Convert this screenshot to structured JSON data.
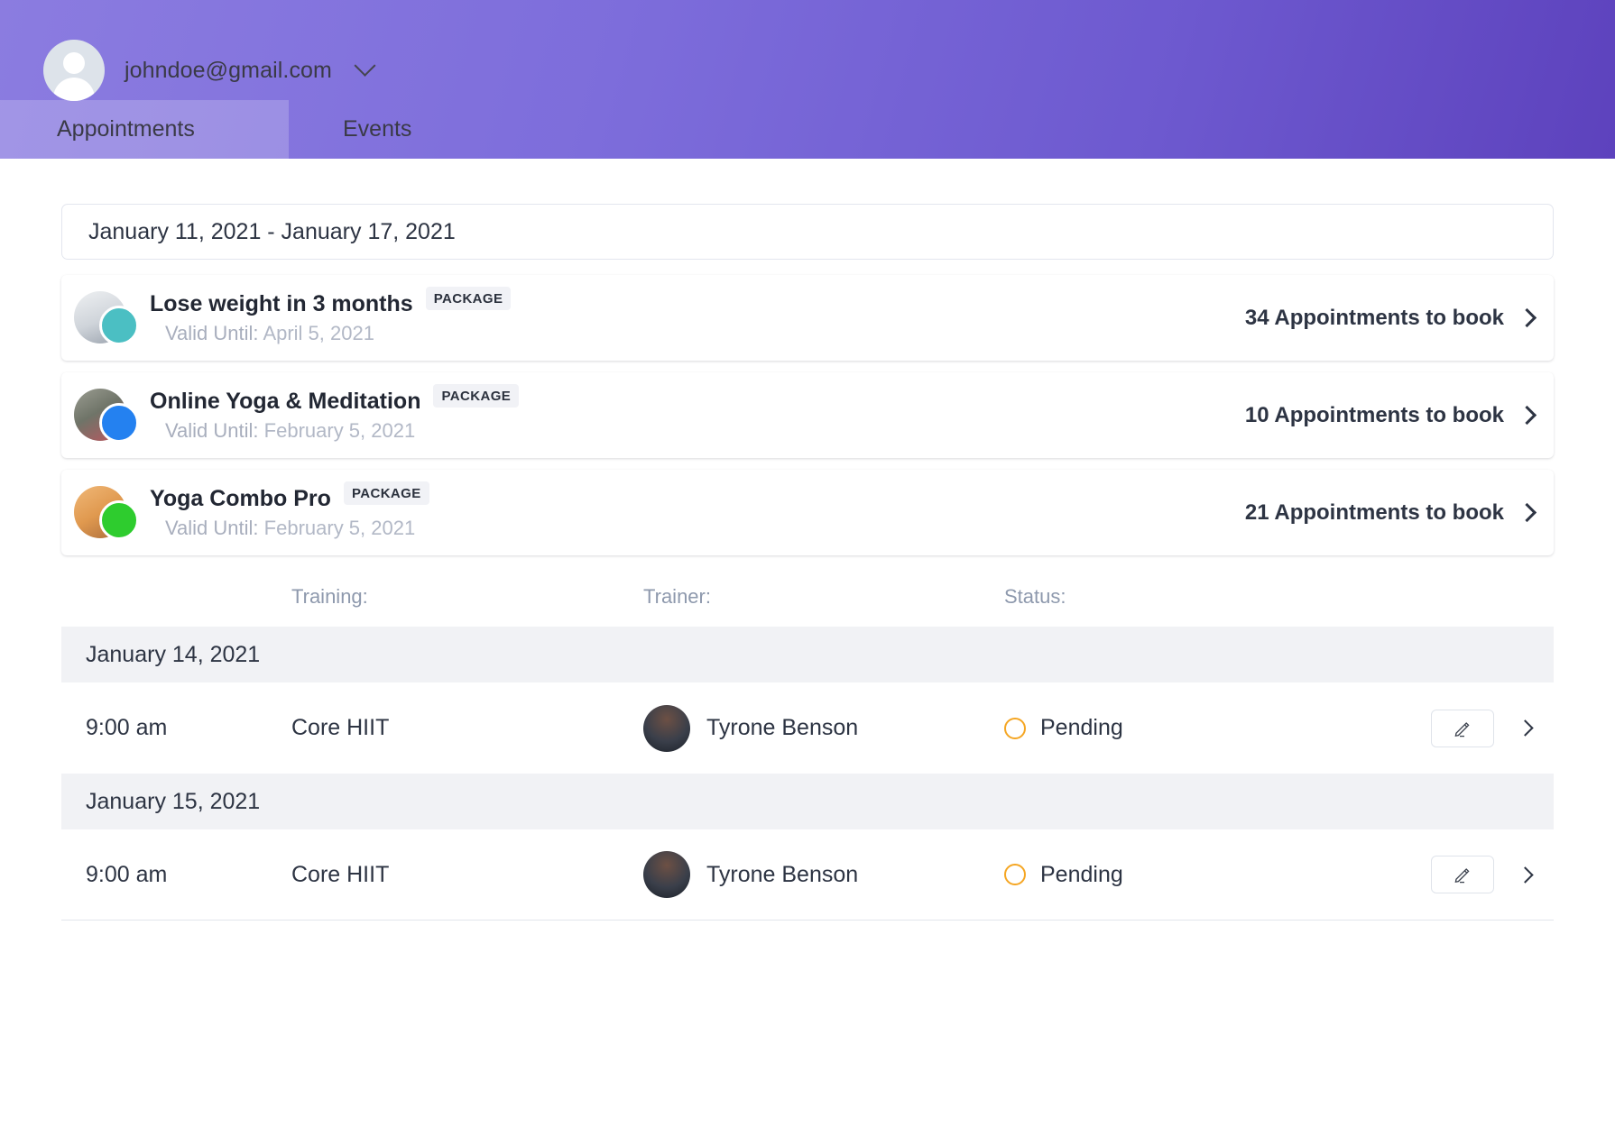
{
  "header": {
    "account_email": "johndoe@gmail.com",
    "avatar_icon": "user-avatar-icon",
    "dropdown_icon": "chevron-down-icon",
    "gradient_from": "#8b7ce0",
    "gradient_to": "#5d42bd"
  },
  "tabs": [
    {
      "label": "Appointments",
      "active": true
    },
    {
      "label": "Events",
      "active": false
    }
  ],
  "date_range": {
    "value": "January 11, 2021 - January 17, 2021",
    "placeholder": "Select date range"
  },
  "packages": [
    {
      "title": "Lose weight in 3 months",
      "badge": "PACKAGE",
      "valid_label": "Valid Until:",
      "valid_date": "April 5, 2021",
      "count_text": "34 Appointments to book",
      "dot_color": "#4bbfc3",
      "photo_color": "#d6d9de"
    },
    {
      "title": "Online Yoga & Meditation",
      "badge": "PACKAGE",
      "valid_label": "Valid Until:",
      "valid_date": "February 5, 2021",
      "count_text": "10 Appointments to book",
      "dot_color": "#2481f0",
      "photo_color": "#8d8f83"
    },
    {
      "title": "Yoga Combo Pro",
      "badge": "PACKAGE",
      "valid_label": "Valid Until:",
      "valid_date": "February 5, 2021",
      "count_text": "21 Appointments to book",
      "dot_color": "#2ecc2e",
      "photo_color": "#e8a765"
    }
  ],
  "table": {
    "columns": {
      "time": "",
      "training": "Training:",
      "trainer": "Trainer:",
      "status": "Status:"
    },
    "groups": [
      {
        "date": "January 14, 2021",
        "rows": [
          {
            "time": "9:00 am",
            "training": "Core HIIT",
            "trainer": "Tyrone Benson",
            "status": "Pending",
            "status_color": "#f5a623",
            "edit_icon": "pencil-icon",
            "open_icon": "chevron-right-icon"
          }
        ]
      },
      {
        "date": "January 15, 2021",
        "rows": [
          {
            "time": "9:00 am",
            "training": "Core HIIT",
            "trainer": "Tyrone Benson",
            "status": "Pending",
            "status_color": "#f5a623",
            "edit_icon": "pencil-icon",
            "open_icon": "chevron-right-icon"
          }
        ]
      }
    ]
  }
}
